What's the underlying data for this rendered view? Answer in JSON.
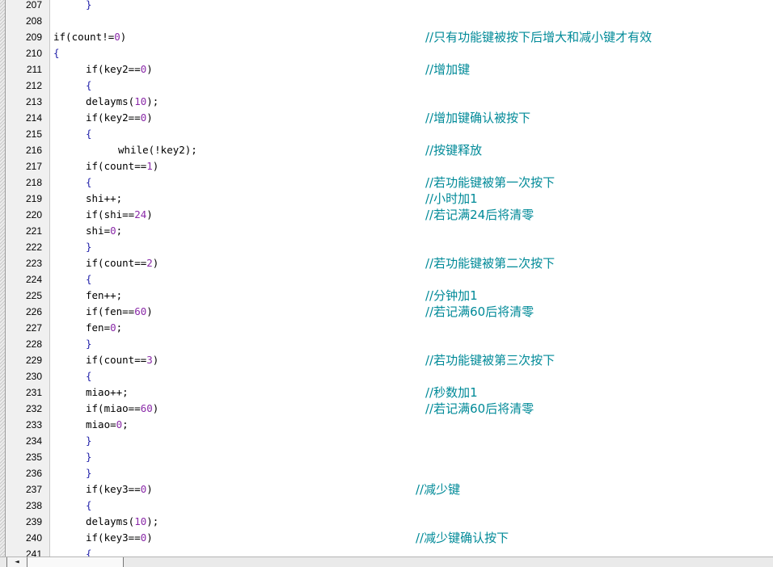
{
  "editor": {
    "lines": [
      {
        "n": "207",
        "indent": 1,
        "parts": [
          {
            "t": "}",
            "c": "brace"
          }
        ]
      },
      {
        "n": "208",
        "indent": 0,
        "parts": []
      },
      {
        "n": "209",
        "indent": 0,
        "parts": [
          {
            "t": "if(count!="
          },
          {
            "t": "0",
            "c": "num"
          },
          {
            "t": ")"
          }
        ],
        "comment": "//只有功能键被按下后增大和减小键才有效"
      },
      {
        "n": "210",
        "indent": 0,
        "parts": [
          {
            "t": "{",
            "c": "brace"
          }
        ]
      },
      {
        "n": "211",
        "indent": 1,
        "parts": [
          {
            "t": "if(key2=="
          },
          {
            "t": "0",
            "c": "num"
          },
          {
            "t": ")"
          }
        ],
        "comment": "//增加键"
      },
      {
        "n": "212",
        "indent": 1,
        "parts": [
          {
            "t": "{",
            "c": "brace"
          }
        ]
      },
      {
        "n": "213",
        "indent": 1,
        "parts": [
          {
            "t": "delayms("
          },
          {
            "t": "10",
            "c": "num"
          },
          {
            "t": ");"
          }
        ]
      },
      {
        "n": "214",
        "indent": 1,
        "parts": [
          {
            "t": "if(key2=="
          },
          {
            "t": "0",
            "c": "num"
          },
          {
            "t": ")"
          }
        ],
        "comment": "//增加键确认被按下"
      },
      {
        "n": "215",
        "indent": 1,
        "parts": [
          {
            "t": "{",
            "c": "brace"
          }
        ]
      },
      {
        "n": "216",
        "indent": 2,
        "parts": [
          {
            "t": "while(!key2);"
          }
        ],
        "comment": "//按键释放"
      },
      {
        "n": "217",
        "indent": 1,
        "parts": [
          {
            "t": "if(count=="
          },
          {
            "t": "1",
            "c": "num"
          },
          {
            "t": ")"
          }
        ]
      },
      {
        "n": "218",
        "indent": 1,
        "parts": [
          {
            "t": "{",
            "c": "brace"
          }
        ],
        "comment": "//若功能键被第一次按下"
      },
      {
        "n": "219",
        "indent": 1,
        "parts": [
          {
            "t": "shi++;"
          }
        ],
        "comment": "//小时加1"
      },
      {
        "n": "220",
        "indent": 1,
        "parts": [
          {
            "t": "if(shi=="
          },
          {
            "t": "24",
            "c": "num"
          },
          {
            "t": ")"
          }
        ],
        "comment": "//若记满24后将清零"
      },
      {
        "n": "221",
        "indent": 1,
        "parts": [
          {
            "t": "shi="
          },
          {
            "t": "0",
            "c": "num"
          },
          {
            "t": ";"
          }
        ]
      },
      {
        "n": "222",
        "indent": 1,
        "parts": [
          {
            "t": "}",
            "c": "brace"
          }
        ]
      },
      {
        "n": "223",
        "indent": 1,
        "parts": [
          {
            "t": "if(count=="
          },
          {
            "t": "2",
            "c": "num"
          },
          {
            "t": ")"
          }
        ],
        "comment": "//若功能键被第二次按下"
      },
      {
        "n": "224",
        "indent": 1,
        "parts": [
          {
            "t": "{",
            "c": "brace"
          }
        ]
      },
      {
        "n": "225",
        "indent": 1,
        "parts": [
          {
            "t": "fen++;"
          }
        ],
        "comment": "//分钟加1"
      },
      {
        "n": "226",
        "indent": 1,
        "parts": [
          {
            "t": "if(fen=="
          },
          {
            "t": "60",
            "c": "num"
          },
          {
            "t": ")"
          }
        ],
        "comment": "//若记满60后将清零"
      },
      {
        "n": "227",
        "indent": 1,
        "parts": [
          {
            "t": "fen="
          },
          {
            "t": "0",
            "c": "num"
          },
          {
            "t": ";"
          }
        ]
      },
      {
        "n": "228",
        "indent": 1,
        "parts": [
          {
            "t": "}",
            "c": "brace"
          }
        ]
      },
      {
        "n": "229",
        "indent": 1,
        "parts": [
          {
            "t": "if(count=="
          },
          {
            "t": "3",
            "c": "num"
          },
          {
            "t": ")"
          }
        ],
        "comment": "//若功能键被第三次按下"
      },
      {
        "n": "230",
        "indent": 1,
        "parts": [
          {
            "t": "{",
            "c": "brace"
          }
        ]
      },
      {
        "n": "231",
        "indent": 1,
        "parts": [
          {
            "t": "miao++;"
          }
        ],
        "comment": "//秒数加1"
      },
      {
        "n": "232",
        "indent": 1,
        "parts": [
          {
            "t": "if(miao=="
          },
          {
            "t": "60",
            "c": "num"
          },
          {
            "t": ")"
          }
        ],
        "comment": "//若记满60后将清零"
      },
      {
        "n": "233",
        "indent": 1,
        "parts": [
          {
            "t": "miao="
          },
          {
            "t": "0",
            "c": "num"
          },
          {
            "t": ";"
          }
        ]
      },
      {
        "n": "234",
        "indent": 1,
        "parts": [
          {
            "t": "}",
            "c": "brace"
          }
        ]
      },
      {
        "n": "235",
        "indent": 1,
        "parts": [
          {
            "t": "}",
            "c": "brace"
          }
        ]
      },
      {
        "n": "236",
        "indent": 1,
        "parts": [
          {
            "t": "}",
            "c": "brace"
          }
        ]
      },
      {
        "n": "237",
        "indent": 1,
        "parts": [
          {
            "t": "if(key3=="
          },
          {
            "t": "0",
            "c": "num"
          },
          {
            "t": ")"
          }
        ],
        "comment": "//减少键",
        "commentShift": -12
      },
      {
        "n": "238",
        "indent": 1,
        "parts": [
          {
            "t": "{",
            "c": "brace"
          }
        ]
      },
      {
        "n": "239",
        "indent": 1,
        "parts": [
          {
            "t": "delayms("
          },
          {
            "t": "10",
            "c": "num"
          },
          {
            "t": ");"
          }
        ]
      },
      {
        "n": "240",
        "indent": 1,
        "parts": [
          {
            "t": "if(key3=="
          },
          {
            "t": "0",
            "c": "num"
          },
          {
            "t": ")"
          }
        ],
        "comment": "//减少键确认按下",
        "commentShift": -12
      },
      {
        "n": "241",
        "indent": 1,
        "parts": [
          {
            "t": "{",
            "c": "brace"
          }
        ]
      }
    ]
  },
  "scrollbar": {
    "left_arrow_label": "◄"
  }
}
